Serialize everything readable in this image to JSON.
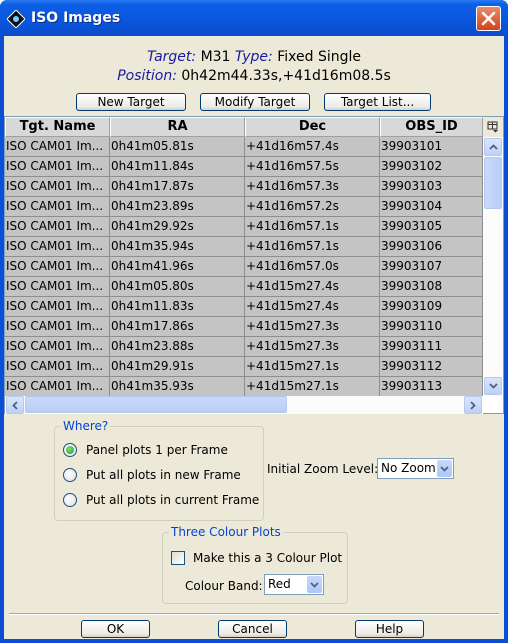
{
  "window": {
    "title": "ISO Images",
    "icon": "app-diamond-icon",
    "close_icon": "close-icon"
  },
  "info": {
    "target_label": "Target:",
    "target_value": "M31",
    "type_label": "Type:",
    "type_value": "Fixed Single",
    "position_label": "Position:",
    "position_value": "0h42m44.33s,+41d16m08.5s"
  },
  "target_buttons": {
    "new_target": "New Target",
    "modify_target": "Modify Target",
    "target_list": "Target List..."
  },
  "table": {
    "columns": [
      "Tgt. Name",
      "RA",
      "Dec",
      "OBS_ID"
    ],
    "rows": [
      [
        "ISO CAM01  Im...",
        "0h41m05.81s",
        "+41d16m57.4s",
        "39903101"
      ],
      [
        "ISO CAM01  Im...",
        "0h41m11.84s",
        "+41d16m57.5s",
        "39903102"
      ],
      [
        "ISO CAM01  Im...",
        "0h41m17.87s",
        "+41d16m57.3s",
        "39903103"
      ],
      [
        "ISO CAM01  Im...",
        "0h41m23.89s",
        "+41d16m57.2s",
        "39903104"
      ],
      [
        "ISO CAM01  Im...",
        "0h41m29.92s",
        "+41d16m57.1s",
        "39903105"
      ],
      [
        "ISO CAM01  Im...",
        "0h41m35.94s",
        "+41d16m57.1s",
        "39903106"
      ],
      [
        "ISO CAM01  Im...",
        "0h41m41.96s",
        "+41d16m57.0s",
        "39903107"
      ],
      [
        "ISO CAM01  Im...",
        "0h41m05.80s",
        "+41d15m27.4s",
        "39903108"
      ],
      [
        "ISO CAM01  Im...",
        "0h41m11.83s",
        "+41d15m27.4s",
        "39903109"
      ],
      [
        "ISO CAM01  Im...",
        "0h41m17.86s",
        "+41d15m27.3s",
        "39903110"
      ],
      [
        "ISO CAM01  Im...",
        "0h41m23.88s",
        "+41d15m27.3s",
        "39903111"
      ],
      [
        "ISO CAM01  Im...",
        "0h41m29.91s",
        "+41d15m27.1s",
        "39903112"
      ],
      [
        "ISO CAM01  Im...",
        "0h41m35.93s",
        "+41d15m27.1s",
        "39903113"
      ]
    ]
  },
  "where": {
    "title": "Where?",
    "options": [
      {
        "label": "Panel plots 1 per Frame",
        "selected": true
      },
      {
        "label": "Put all plots in new Frame",
        "selected": false
      },
      {
        "label": "Put all plots in current Frame",
        "selected": false
      }
    ]
  },
  "zoom": {
    "label": "Initial Zoom Level:",
    "value": "No Zoom"
  },
  "three_colour": {
    "title": "Three Colour Plots",
    "checkbox_label": "Make this a 3 Colour Plot",
    "checked": false,
    "band_label": "Colour Band:",
    "band_value": "Red"
  },
  "dialog_buttons": {
    "ok": "OK",
    "cancel": "Cancel",
    "help": "Help"
  }
}
